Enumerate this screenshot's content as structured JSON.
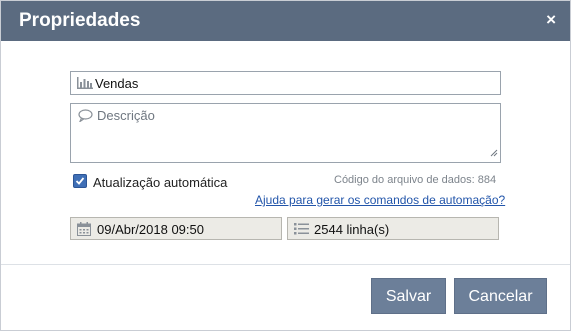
{
  "dialog": {
    "title": "Propriedades",
    "close_symbol": "×"
  },
  "form": {
    "name_value": "Vendas",
    "name_icon": "bar-chart-icon",
    "description_placeholder": "Descrição",
    "description_icon": "speech-bubble-icon",
    "auto_update_label": "Atualização automática",
    "auto_update_checked": true,
    "data_file_code": "Código do arquivo de dados: 884",
    "help_link": "Ajuda para gerar os comandos de automação?",
    "date_value": "09/Abr/2018 09:50",
    "date_icon": "calendar-icon",
    "rows_value": "2544 linha(s)",
    "rows_icon": "list-icon"
  },
  "buttons": {
    "save_label": "Salvar",
    "cancel_label": "Cancelar"
  },
  "colors": {
    "header": "#5b6b80",
    "button": "#6c7f99",
    "checkbox": "#3f6fb6",
    "link": "#2255aa"
  }
}
